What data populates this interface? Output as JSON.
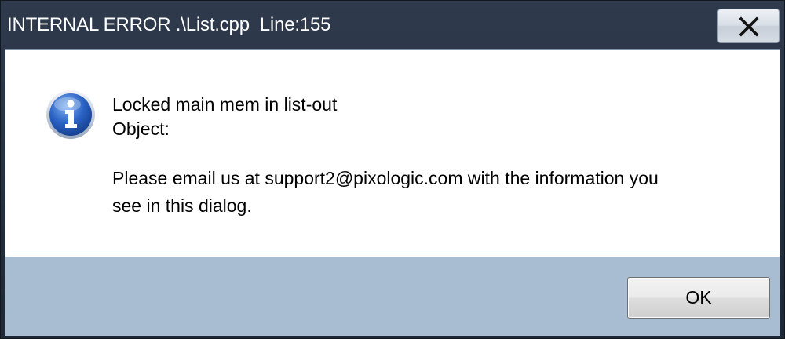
{
  "window": {
    "title": "INTERNAL ERROR .\\List.cpp  Line:155"
  },
  "message": {
    "icon": "information-icon",
    "line1": "Locked main mem in list-out",
    "line2": "Object:",
    "line3": "Please email us at support2@pixologic.com with the information you",
    "line4": "see in this dialog."
  },
  "buttons": {
    "ok_label": "OK",
    "close_icon": "close-icon"
  },
  "colors": {
    "titlebar": "#2a3546",
    "footer": "#a8bcd2",
    "icon_blue": "#1f4fa8"
  }
}
